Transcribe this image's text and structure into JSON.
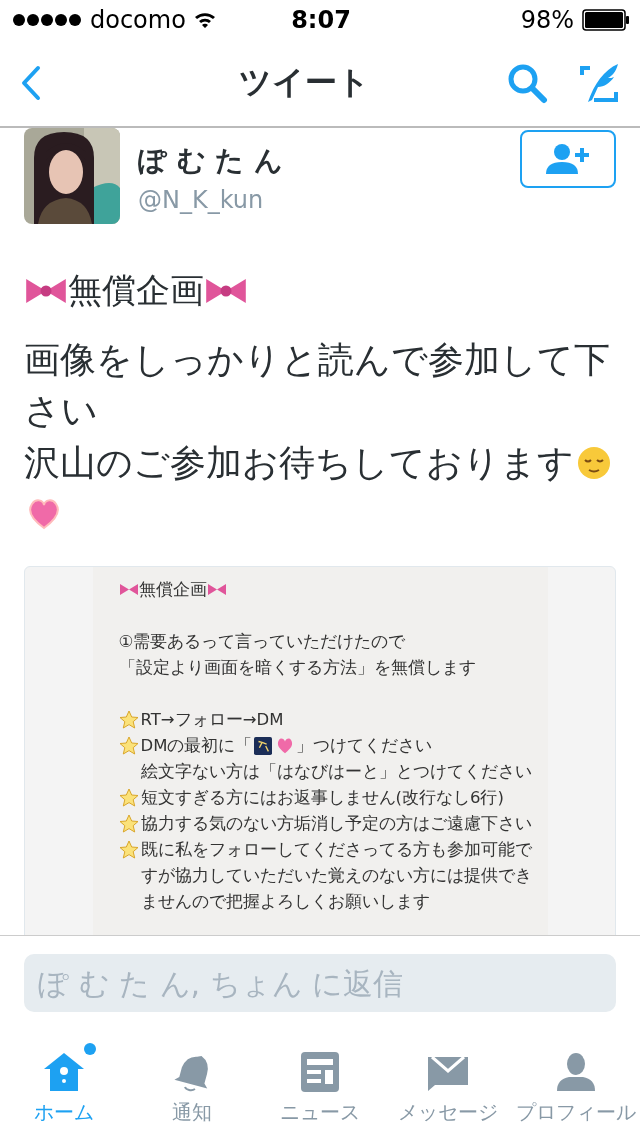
{
  "status_bar": {
    "carrier": "docomo",
    "time": "8:07",
    "battery": "98%"
  },
  "nav": {
    "title": "ツイート"
  },
  "author": {
    "name": "ぽ む た ん",
    "handle": "@N_K_kun"
  },
  "tweet": {
    "title": "無償企画",
    "paragraphs": [
      "画像をしっかりと読んで参加して下さい",
      "沢山のご参加お待ちしております"
    ]
  },
  "attachment": {
    "lines": [
      {
        "kind": "title",
        "text": "無償企画"
      },
      {
        "kind": "blank"
      },
      {
        "kind": "plain",
        "text": "①需要あるって言っていただけたので"
      },
      {
        "kind": "plain",
        "text": "「設定より画面を暗くする方法」を無償します"
      },
      {
        "kind": "blank"
      },
      {
        "kind": "star",
        "text": "RT→フォロー→DM"
      },
      {
        "kind": "icons",
        "text": "DMの最初に「",
        "after": "」つけてください"
      },
      {
        "kind": "indent",
        "text": "絵文字ない方は「はなびはーと」とつけてください"
      },
      {
        "kind": "star",
        "text": "短文すぎる方にはお返事しません(改行なし6行)"
      },
      {
        "kind": "star",
        "text": "協力する気のない方垢消し予定の方はご遠慮下さい"
      },
      {
        "kind": "star",
        "text": "既に私をフォローしてくださってる方も参加可能で"
      },
      {
        "kind": "indent",
        "text": "すが協力していただいた覚えのない方には提供でき"
      },
      {
        "kind": "indent",
        "text": "ませんので把握よろしくお願いします"
      }
    ]
  },
  "reply": {
    "placeholder": "ぽ む た ん, ちょん に返信"
  },
  "tabs": [
    {
      "label": "ホーム",
      "selected": true,
      "badge": true
    },
    {
      "label": "通知",
      "selected": false,
      "badge": false
    },
    {
      "label": "ニュース",
      "selected": false,
      "badge": false
    },
    {
      "label": "メッセージ",
      "selected": false,
      "badge": false
    },
    {
      "label": "プロフィール",
      "selected": false,
      "badge": false
    }
  ]
}
